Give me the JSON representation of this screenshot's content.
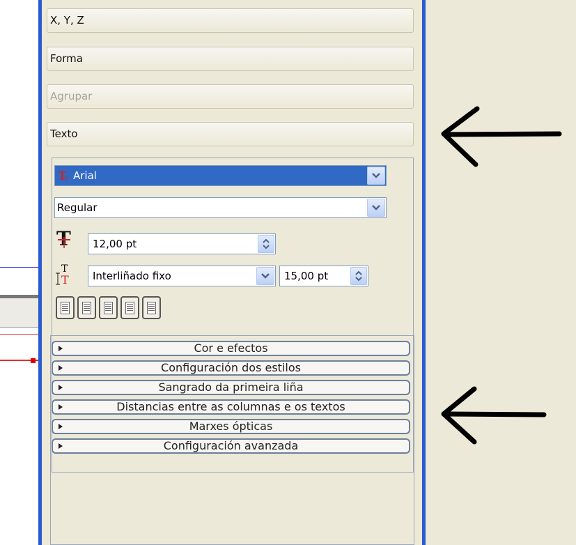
{
  "sections": {
    "xyz": "X, Y, Z",
    "forma": "Forma",
    "agrupar": "Agrupar",
    "texto": "Texto"
  },
  "text": {
    "font_family": "Arial",
    "font_style": "Regular",
    "font_size": "12,00 pt",
    "line_spacing_mode": "Interliñado fixo",
    "line_spacing_value": "15,00 pt"
  },
  "expanders": [
    "Cor e efectos",
    "Configuración dos estilos",
    "Sangrado da primeira liña",
    "Distancias entre as columnas e os textos",
    "Marxes ópticas",
    "Configuración avanzada"
  ],
  "icons": {
    "font": "font-type-icon",
    "size": "font-size-icon",
    "linespacing": "line-spacing-icon",
    "dropdown": "chevron-down-icon",
    "spin": "spinner-arrows-icon",
    "annotation": "arrow-left-icon"
  },
  "colors": {
    "selection": "#316ac5",
    "border": "#2a5ccf",
    "panel": "#ece9d8"
  }
}
